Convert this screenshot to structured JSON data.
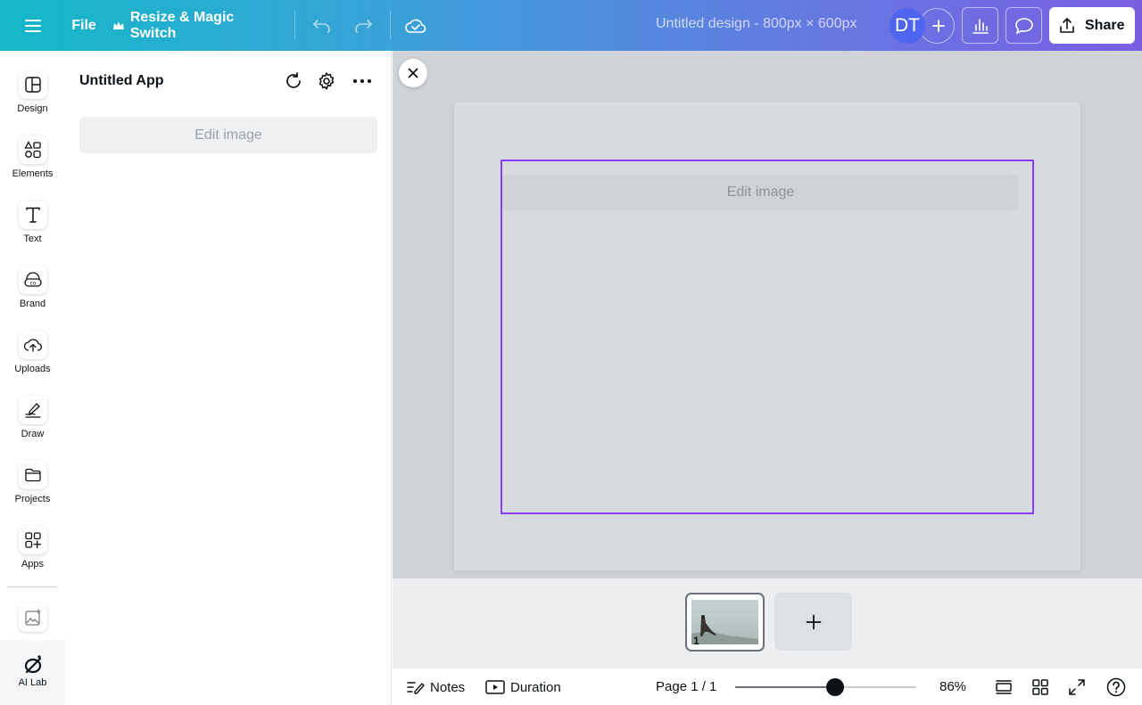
{
  "topbar": {
    "file_label": "File",
    "resize_label": "Resize & Magic Switch",
    "design_title": "Untitled design - 800px × 600px",
    "avatar_initials": "DT",
    "share_label": "Share"
  },
  "rail": {
    "items": [
      {
        "label": "Design",
        "icon": "design-icon"
      },
      {
        "label": "Elements",
        "icon": "elements-icon"
      },
      {
        "label": "Text",
        "icon": "text-icon"
      },
      {
        "label": "Brand",
        "icon": "brand-icon"
      },
      {
        "label": "Uploads",
        "icon": "uploads-icon"
      },
      {
        "label": "Draw",
        "icon": "draw-icon"
      },
      {
        "label": "Projects",
        "icon": "projects-icon"
      },
      {
        "label": "Apps",
        "icon": "apps-icon"
      }
    ],
    "ai_lab_label": "AI Lab"
  },
  "panel": {
    "title": "Untitled App",
    "edit_image_label": "Edit image"
  },
  "canvas": {
    "edit_image_label": "Edit image",
    "selection_color": "#8b3dff"
  },
  "pages": {
    "thumb_number": "1"
  },
  "bottombar": {
    "notes_label": "Notes",
    "duration_label": "Duration",
    "page_indicator": "Page 1 / 1",
    "zoom_value": 0.55,
    "zoom_label": "86%"
  }
}
